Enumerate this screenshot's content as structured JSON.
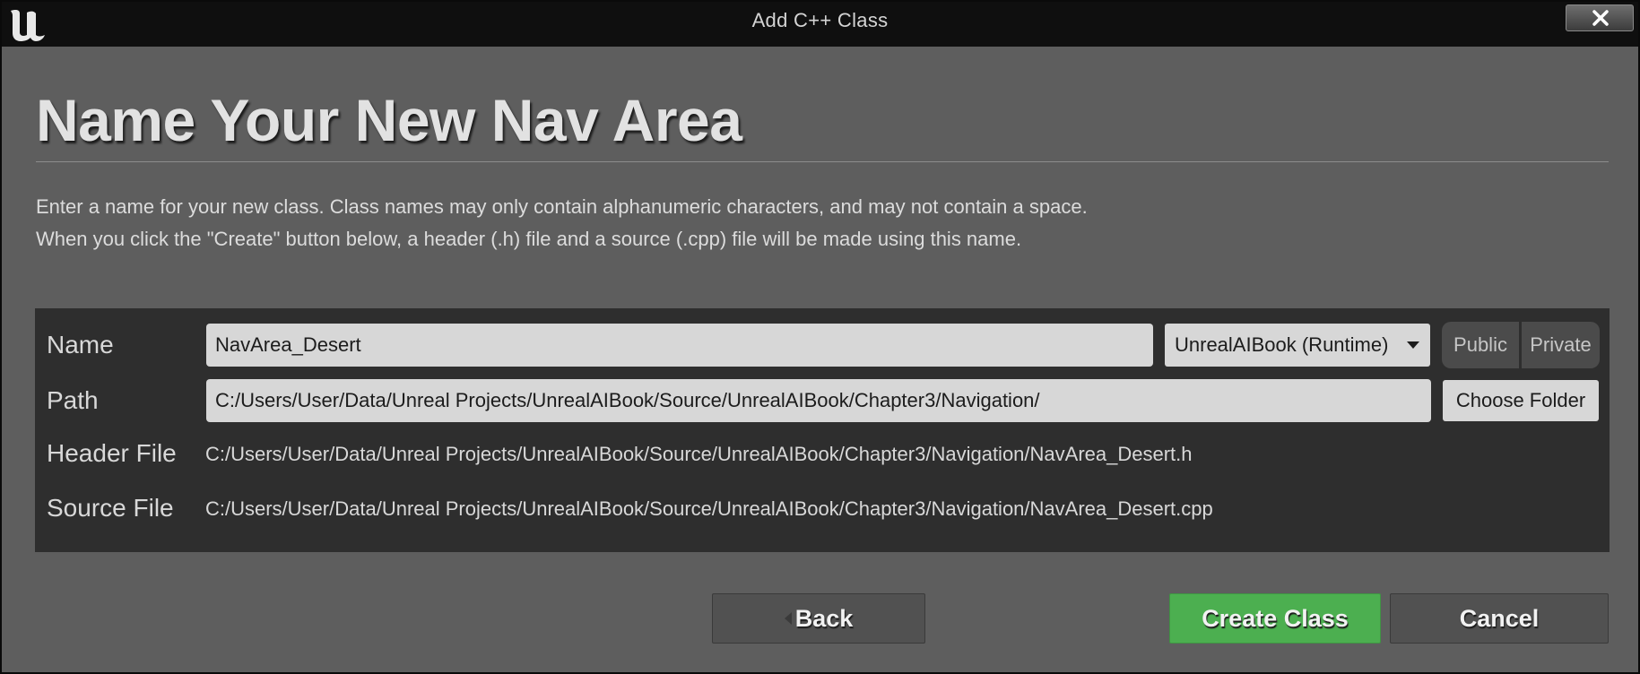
{
  "window": {
    "title": "Add C++ Class",
    "logo_icon": "unreal-engine-logo",
    "close_icon": "close-icon"
  },
  "page": {
    "heading": "Name Your New Nav Area",
    "description_line1": "Enter a name for your new class. Class names may only contain alphanumeric characters, and may not contain a space.",
    "description_line2": "When you click the \"Create\" button below, a header (.h) file and a source (.cpp) file will be made using this name."
  },
  "form": {
    "name_label": "Name",
    "name_value": "NavArea_Desert",
    "module_selected": "UnrealAIBook (Runtime)",
    "visibility_public": "Public",
    "visibility_private": "Private",
    "path_label": "Path",
    "path_value": "C:/Users/User/Data/Unreal Projects/UnrealAIBook/Source/UnrealAIBook/Chapter3/Navigation/",
    "choose_folder_label": "Choose Folder",
    "header_file_label": "Header File",
    "header_file_value": "C:/Users/User/Data/Unreal Projects/UnrealAIBook/Source/UnrealAIBook/Chapter3/Navigation/NavArea_Desert.h",
    "source_file_label": "Source File",
    "source_file_value": "C:/Users/User/Data/Unreal Projects/UnrealAIBook/Source/UnrealAIBook/Chapter3/Navigation/NavArea_Desert.cpp"
  },
  "footer": {
    "back_label": "Back",
    "create_label": "Create Class",
    "cancel_label": "Cancel"
  },
  "colors": {
    "window_bg": "#5e5e5e",
    "titlebar_bg": "#0f0f0f",
    "panel_bg": "#2e2e2e",
    "create_button": "#4caf50"
  }
}
